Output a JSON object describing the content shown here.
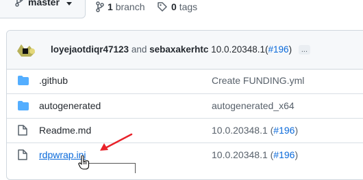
{
  "branch": {
    "name": "master"
  },
  "stats": {
    "branches_count": "1",
    "branches_label": "branch",
    "tags_count": "0",
    "tags_label": "tags"
  },
  "commit": {
    "author1": "loyejaotdiqr47123",
    "and_text": "and",
    "author2": "sebaxakerhtc",
    "message": "10.0.20348.1",
    "pr_open": "(",
    "pr_link": "#196",
    "pr_close": ")",
    "more": "..."
  },
  "files": [
    {
      "type": "folder",
      "name": ".github",
      "message": "Create FUNDING.yml",
      "pr": ""
    },
    {
      "type": "folder",
      "name": "autogenerated",
      "message": "autogenerated_x64",
      "pr": ""
    },
    {
      "type": "file",
      "name": "Readme.md",
      "message": "10.0.20348.1 (",
      "pr": "#196"
    },
    {
      "type": "file",
      "name": "rdpwrap.ini",
      "message": "10.0.20348.1 (",
      "pr": "#196"
    }
  ],
  "colors": {
    "accent": "#0969da",
    "folder": "#54aeff",
    "annotation_arrow": "#e8222a"
  },
  "icons": {
    "branch": "git-branch-icon",
    "tag": "tag-icon",
    "folder": "folder-icon",
    "file": "file-icon",
    "cursor": "hand-pointer-icon"
  }
}
